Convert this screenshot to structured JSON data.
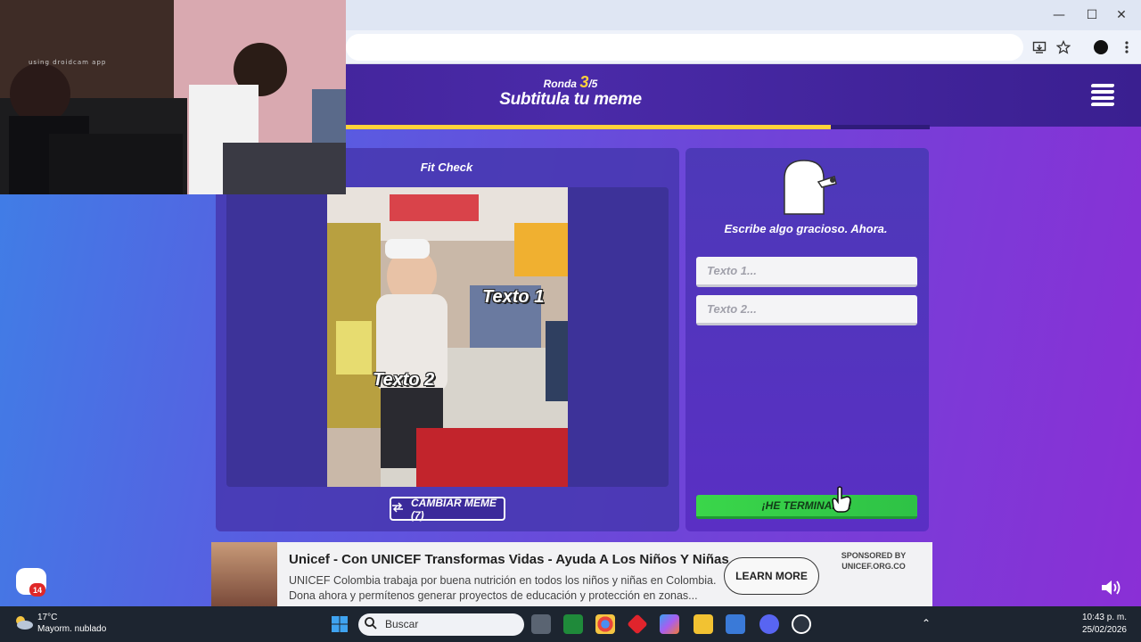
{
  "browser": {
    "window_controls": {
      "minimize": "—",
      "maximize": "☐",
      "close": "✕"
    }
  },
  "game": {
    "round_prefix": "Ronda",
    "round_current": "3",
    "round_total": "/5",
    "title": "Subtitula tu meme",
    "progress": 0.83
  },
  "meme": {
    "title": "Fit Check",
    "text1": "Texto 1",
    "text2": "Texto 2",
    "change_button": "CAMBIAR MEME (7)"
  },
  "caption_panel": {
    "prompt": "Escribe algo gracioso. Ahora.",
    "input1_placeholder": "Texto 1...",
    "input2_placeholder": "Texto 2...",
    "done_button": "¡HE TERMINADO!"
  },
  "ad": {
    "title": "Unicef - Con UNICEF Transformas Vidas - Ayuda A Los Niños Y Niñas",
    "body": "UNICEF Colombia trabaja por buena nutrición en todos los niños y niñas en Colombia. Dona ahora y permítenos generar proyectos de educación y protección en zonas...",
    "cta": "LEARN MORE",
    "sponsor_line1": "SPONSORED BY",
    "sponsor_line2": "UNICEF.ORG.CO"
  },
  "webcam": {
    "note": "using droidcam app"
  },
  "chat": {
    "count": "14"
  },
  "taskbar": {
    "temperature": "17°C",
    "weather": "Mayorm. nublado",
    "search_placeholder": "Buscar",
    "time": "10:43 p. m.",
    "date": "25/02/2026"
  },
  "colors": {
    "accent_yellow": "#ffd23a",
    "done_green": "#2ec246",
    "header_purple": "#3b1e8e"
  }
}
